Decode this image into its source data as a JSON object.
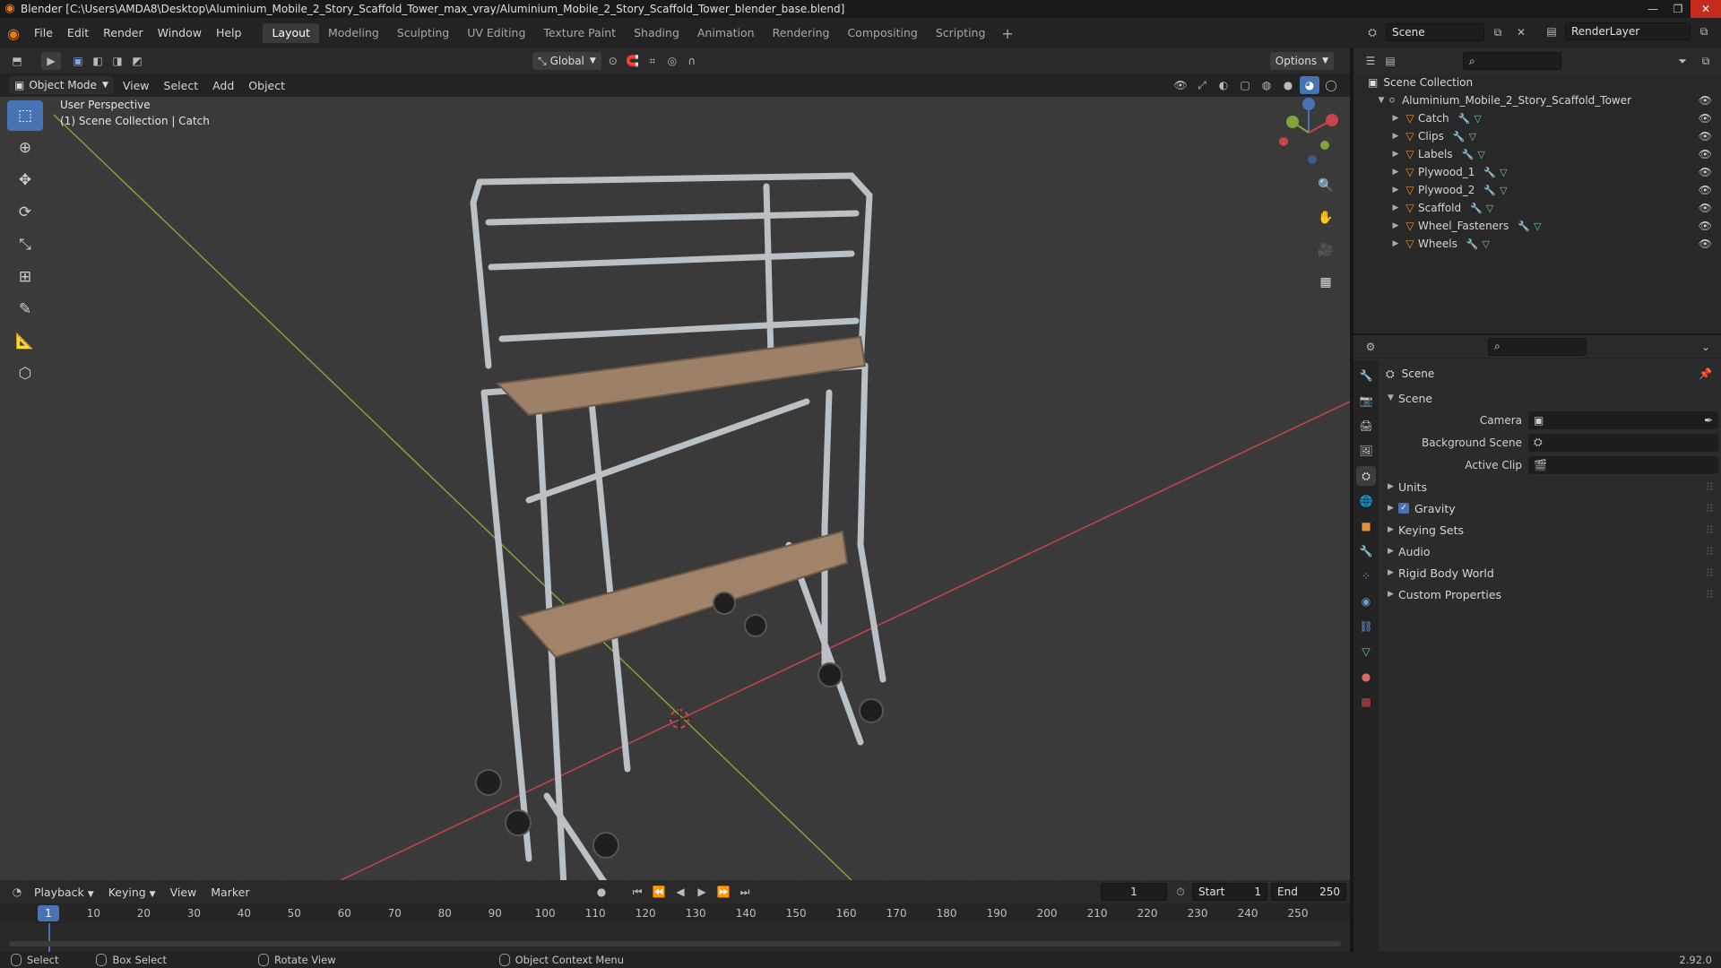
{
  "title_bar": {
    "text": "Blender [C:\\Users\\AMDA8\\Desktop\\Aluminium_Mobile_2_Story_Scaffold_Tower_max_vray/Aluminium_Mobile_2_Story_Scaffold_Tower_blender_base.blend]"
  },
  "menu": [
    "File",
    "Edit",
    "Render",
    "Window",
    "Help"
  ],
  "workspaces": [
    "Layout",
    "Modeling",
    "Sculpting",
    "UV Editing",
    "Texture Paint",
    "Shading",
    "Animation",
    "Rendering",
    "Compositing",
    "Scripting"
  ],
  "scene": {
    "name": "Scene",
    "render_layer": "RenderLayer"
  },
  "viewport": {
    "mode": "Object Mode",
    "menus": [
      "View",
      "Select",
      "Add",
      "Object"
    ],
    "orientation": "Global",
    "options_label": "Options",
    "info_line1": "User Perspective",
    "info_line2": "(1) Scene Collection | Catch"
  },
  "outliner": {
    "root": "Scene Collection",
    "collection": "Aluminium_Mobile_2_Story_Scaffold_Tower",
    "objects": [
      "Catch",
      "Clips",
      "Labels",
      "Plywood_1",
      "Plywood_2",
      "Scaffold",
      "Wheel_Fasteners",
      "Wheels"
    ]
  },
  "properties": {
    "context": "Scene",
    "section": "Scene",
    "rows": {
      "camera": "Camera",
      "background_scene": "Background Scene",
      "active_clip": "Active Clip"
    },
    "panels": [
      "Units",
      "Gravity",
      "Keying Sets",
      "Audio",
      "Rigid Body World",
      "Custom Properties"
    ],
    "gravity_checked": true
  },
  "timeline": {
    "menus": [
      "Playback",
      "Keying",
      "View",
      "Marker"
    ],
    "current_frame": "1",
    "start_label": "Start",
    "start": "1",
    "end_label": "End",
    "end": "250",
    "ticks": [
      "1",
      "10",
      "20",
      "30",
      "40",
      "50",
      "60",
      "70",
      "80",
      "90",
      "100",
      "110",
      "120",
      "130",
      "140",
      "150",
      "160",
      "170",
      "180",
      "190",
      "200",
      "210",
      "220",
      "230",
      "240",
      "250"
    ]
  },
  "status_bar": {
    "select": "Select",
    "box_select": "Box Select",
    "rotate_view": "Rotate View",
    "context_menu": "Object Context Menu",
    "version": "2.92.0"
  },
  "colors": {
    "accent": "#4772b3",
    "object_orange": "#e88d3a",
    "x_axis": "#c9434b",
    "y_axis": "#7ea43a"
  }
}
